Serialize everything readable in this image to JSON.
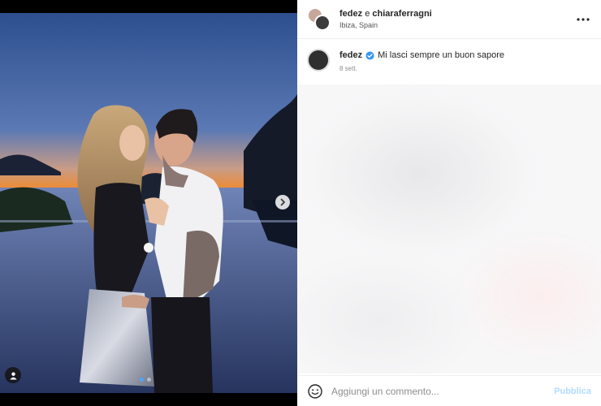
{
  "post": {
    "header": {
      "user1": "fedez",
      "connector": "e",
      "user2": "chiaraferragni",
      "location": "Ibiza, Spain"
    },
    "caption": {
      "username": "fedez",
      "text": "Mi lasci sempre un buon sapore",
      "time": "8 sett."
    },
    "carousel": {
      "slide_count": 2,
      "active_index": 0
    },
    "comment_box": {
      "placeholder": "Aggiungi un commento...",
      "publish_label": "Pubblica"
    }
  },
  "icons": {
    "more": "more-options-icon",
    "verified": "verified-badge-icon",
    "next": "chevron-right-icon",
    "tag": "user-tag-icon",
    "emoji": "emoji-icon"
  },
  "colors": {
    "verified": "#3897f0",
    "publish_disabled": "#b3dbff",
    "active_dot": "#4aa6ff"
  }
}
